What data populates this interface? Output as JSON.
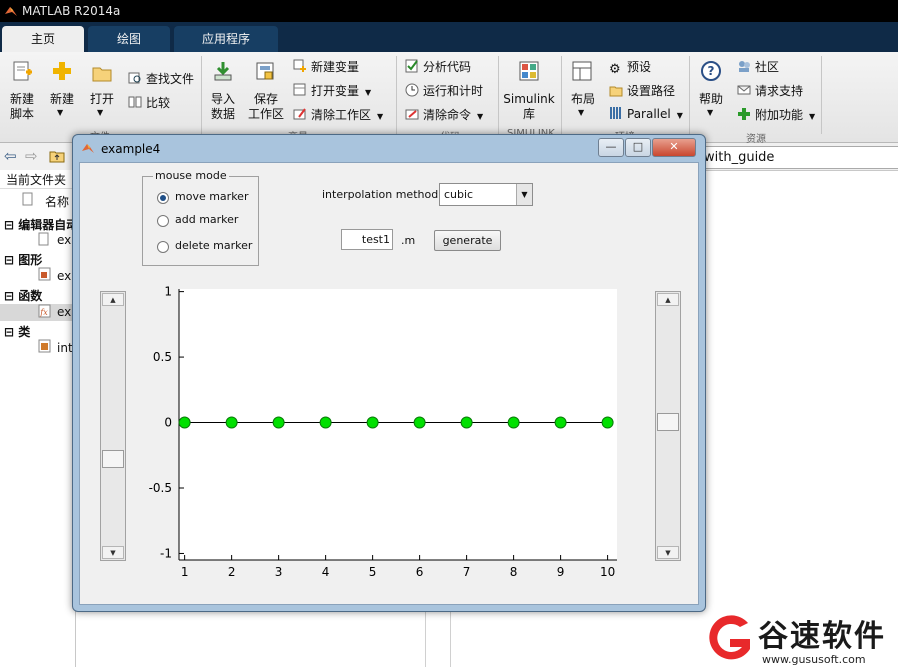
{
  "app": {
    "title": "MATLAB R2014a",
    "tabs": [
      {
        "label": "主页",
        "active": true
      },
      {
        "label": "绘图",
        "active": false
      },
      {
        "label": "应用程序",
        "active": false
      }
    ]
  },
  "ribbon": {
    "new_script": "新建\n脚本",
    "new": "新建",
    "open": "打开",
    "find_files": "查找文件",
    "compare": "比较",
    "import_data": "导入\n数据",
    "save_workspace": "保存\n工作区",
    "new_variable": "新建变量",
    "open_variable": "打开变量",
    "clear_workspace": "清除工作区",
    "analyze_code": "分析代码",
    "run_and_time": "运行和计时",
    "clear_commands": "清除命令",
    "simulink": "Simulink\n库",
    "layout": "布局",
    "preferences": "预设",
    "set_path": "设置路径",
    "parallel": "Parallel",
    "help": "帮助",
    "community": "社区",
    "request_support": "请求支持",
    "add_ons": "附加功能",
    "group_file": "文件",
    "group_variable": "变量",
    "group_code": "代码",
    "group_simulink": "SIMULINK",
    "group_environment": "环境",
    "group_resources": "资源"
  },
  "address": {
    "current_folder_label": "当前文件夹",
    "path_tail": "with_guide"
  },
  "sidebar": {
    "name_header": "名称",
    "sections": [
      {
        "label": "编辑器自动",
        "item": "exa"
      },
      {
        "label": "图形",
        "item": "exa"
      },
      {
        "label": "函数",
        "item": "exa"
      },
      {
        "label": "类",
        "item": "int"
      }
    ]
  },
  "figure": {
    "title": "example4",
    "mouse_mode": {
      "legend": "mouse mode",
      "options": [
        "move marker",
        "add marker",
        "delete marker"
      ],
      "selected": "move marker"
    },
    "interp_label": "interpolation method:",
    "interp_value": "cubic",
    "filename_value": "test1",
    "ext_label": ".m",
    "generate_label": "generate",
    "left_slider_level": 0.35,
    "right_slider_level": 0.52,
    "minimize": "—",
    "maximize": "□",
    "close": "✕"
  },
  "chart_data": {
    "type": "line",
    "x": [
      1,
      2,
      3,
      4,
      5,
      6,
      7,
      8,
      9,
      10
    ],
    "y": [
      0,
      0,
      0,
      0,
      0,
      0,
      0,
      0,
      0,
      0
    ],
    "xlim": [
      0.88,
      10.2
    ],
    "ylim": [
      -1.05,
      1.02
    ],
    "xticks": [
      "1",
      "2",
      "3",
      "4",
      "5",
      "6",
      "7",
      "8",
      "9",
      "10"
    ],
    "yticks": [
      "1",
      "0.5",
      "0",
      "-0.5",
      "-1"
    ],
    "ytick_values": [
      1,
      0.5,
      0,
      -0.5,
      -1
    ],
    "line_color": "#000000",
    "marker_color": "#00e000"
  },
  "watermark": {
    "text": "谷速软件",
    "url": "www.gususoft.com",
    "brand_color": "#e8292b"
  }
}
